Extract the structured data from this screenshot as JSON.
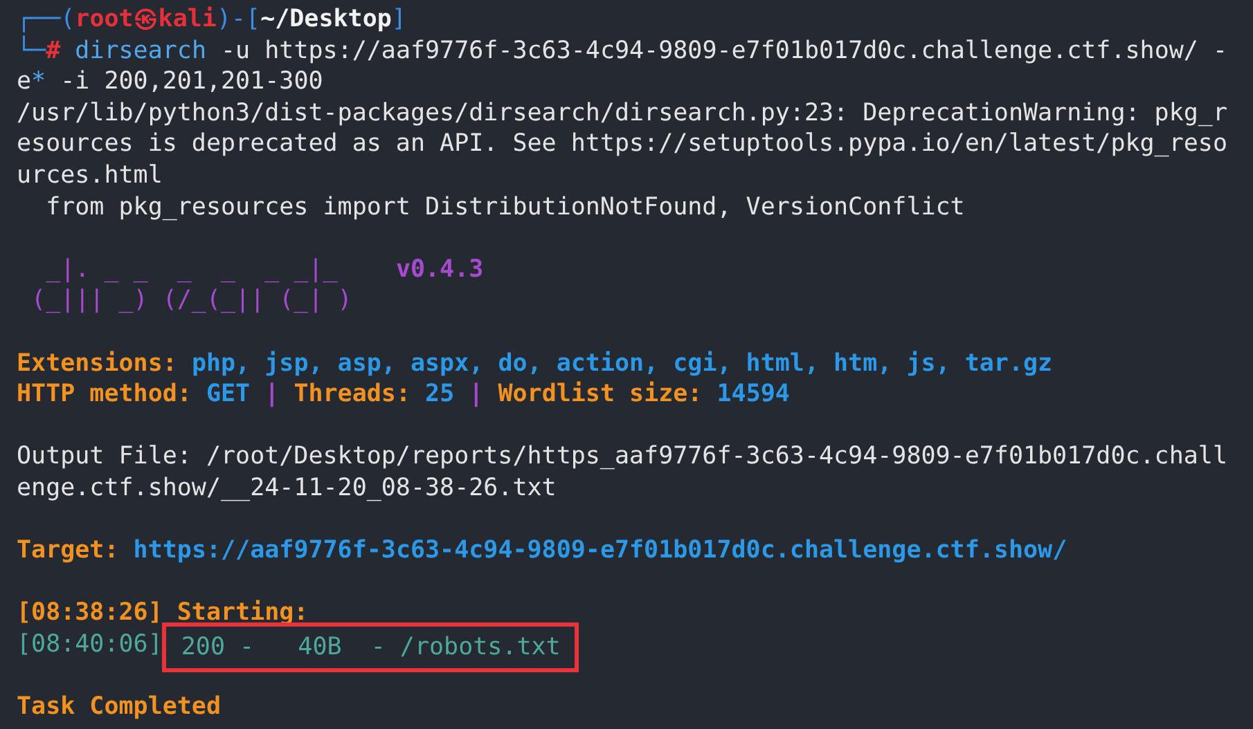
{
  "terminal": {
    "lines": [
      {
        "kind": "output",
        "segments": [
          {
            "text": "┌──(",
            "kind": "frame"
          },
          {
            "text": "root㉿kali",
            "kind": "user"
          },
          {
            "text": ")-[",
            "kind": "frame"
          },
          {
            "text": "~/Desktop",
            "kind": "path"
          },
          {
            "text": "]",
            "kind": "frame"
          }
        ]
      },
      {
        "kind": "output",
        "segments": [
          {
            "text": "└─",
            "kind": "frame"
          },
          {
            "text": "#",
            "kind": "user"
          },
          {
            "text": " dirsearch",
            "kind": "cmd"
          },
          {
            "text": " -u https://aaf9776f-3c63-4c94-9809-e7f01b017d0c.challenge.ctf.show/ -",
            "kind": "text"
          }
        ]
      },
      {
        "kind": "output",
        "segments": [
          {
            "text": "e",
            "kind": "text"
          },
          {
            "text": "*",
            "kind": "cmd"
          },
          {
            "text": " -i 200,201,201-300",
            "kind": "text"
          }
        ]
      },
      {
        "kind": "output",
        "segments": [
          {
            "text": "/usr/lib/python3/dist-packages/dirsearch/dirsearch.py:23: DeprecationWarning: pkg_r",
            "kind": "text"
          }
        ]
      },
      {
        "kind": "output",
        "segments": [
          {
            "text": "esources is deprecated as an API. See https://setuptools.pypa.io/en/latest/pkg_reso",
            "kind": "text"
          }
        ]
      },
      {
        "kind": "output",
        "segments": [
          {
            "text": "urces.html",
            "kind": "text"
          }
        ]
      },
      {
        "kind": "output",
        "segments": [
          {
            "text": "  from pkg_resources import DistributionNotFound, VersionConflict",
            "kind": "text"
          }
        ]
      },
      {
        "kind": "blank"
      },
      {
        "kind": "output",
        "segments": [
          {
            "text": "  _|. _ _  _  _  _ _|_",
            "kind": "banner"
          },
          {
            "text": "    v0.4.3",
            "kind": "version"
          }
        ]
      },
      {
        "kind": "output",
        "segments": [
          {
            "text": " (_||| _) (/_(_|| (_| )",
            "kind": "banner"
          }
        ]
      },
      {
        "kind": "blank"
      },
      {
        "kind": "output",
        "segments": [
          {
            "text": "Extensions:",
            "kind": "label"
          },
          {
            "text": " php, jsp, asp, aspx, do, action, cgi, html, htm, js, tar.gz",
            "kind": "value"
          }
        ]
      },
      {
        "kind": "output",
        "segments": [
          {
            "text": "HTTP method:",
            "kind": "label"
          },
          {
            "text": " GET",
            "kind": "value"
          },
          {
            "text": " | ",
            "kind": "sep"
          },
          {
            "text": "Threads:",
            "kind": "label"
          },
          {
            "text": " 25",
            "kind": "value"
          },
          {
            "text": " | ",
            "kind": "sep"
          },
          {
            "text": "Wordlist size:",
            "kind": "label"
          },
          {
            "text": " 14594",
            "kind": "value"
          }
        ]
      },
      {
        "kind": "blank"
      },
      {
        "kind": "output",
        "segments": [
          {
            "text": "Output File: /root/Desktop/reports/https_aaf9776f-3c63-4c94-9809-e7f01b017d0c.chall",
            "kind": "text"
          }
        ]
      },
      {
        "kind": "output",
        "segments": [
          {
            "text": "enge.ctf.show/__24-11-20_08-38-26.txt",
            "kind": "text"
          }
        ]
      },
      {
        "kind": "blank"
      },
      {
        "kind": "output",
        "segments": [
          {
            "text": "Target:",
            "kind": "label"
          },
          {
            "text": " https://aaf9776f-3c63-4c94-9809-e7f01b017d0c.challenge.ctf.show/",
            "kind": "value"
          }
        ]
      },
      {
        "kind": "blank"
      },
      {
        "kind": "output",
        "segments": [
          {
            "text": "[08:38:26] Starting:",
            "kind": "label"
          }
        ]
      },
      {
        "kind": "output",
        "segments": [
          {
            "text": "[08:40:06]",
            "kind": "time"
          },
          {
            "text": " 200 -   40B  - /robots.txt",
            "kind": "boxed"
          }
        ]
      },
      {
        "kind": "blank"
      },
      {
        "kind": "output",
        "segments": [
          {
            "text": "Task Completed",
            "kind": "label"
          }
        ]
      }
    ]
  }
}
